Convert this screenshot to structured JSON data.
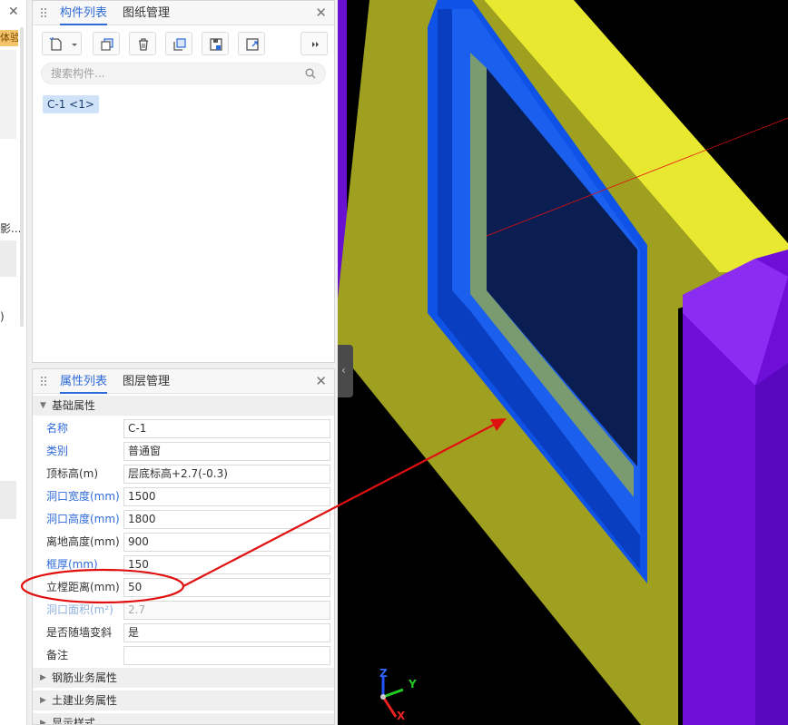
{
  "left_strip": {
    "close": "✕",
    "badge_text": "体验",
    "fragment_text": "影...",
    "fragment_text_2": ")"
  },
  "component_panel": {
    "tabs": [
      {
        "label": "构件列表",
        "active": true
      },
      {
        "label": "图纸管理",
        "active": false
      }
    ],
    "close": "✕",
    "toolbar": [
      "new-component-icon",
      "copy-icon",
      "delete-icon",
      "duplicate-icon",
      "save-icon",
      "export-icon",
      "more-icon"
    ],
    "search_placeholder": "搜索构件...",
    "items": [
      {
        "label": "C-1 <1>"
      }
    ]
  },
  "property_panel": {
    "tabs": [
      {
        "label": "属性列表",
        "active": true
      },
      {
        "label": "图层管理",
        "active": false
      }
    ],
    "close": "✕",
    "sections": {
      "basic": "基础属性",
      "rebar": "钢筋业务属性",
      "civil": "土建业务属性",
      "display": "显示样式"
    },
    "rows": [
      {
        "name": "名称",
        "value": "C-1"
      },
      {
        "name": "类别",
        "value": "普通窗"
      },
      {
        "name": "顶标高(m)",
        "value": "层底标高+2.7(-0.3)"
      },
      {
        "name": "洞口宽度(mm)",
        "value": "1500"
      },
      {
        "name": "洞口高度(mm)",
        "value": "1800"
      },
      {
        "name": "离地高度(mm)",
        "value": "900"
      },
      {
        "name": "框厚(mm)",
        "value": "150"
      },
      {
        "name": "立樘距离(mm)",
        "value": "50"
      },
      {
        "name": "洞口面积(m²)",
        "value": "2.7"
      },
      {
        "name": "是否随墙变斜",
        "value": "是"
      },
      {
        "name": "备注",
        "value": ""
      }
    ]
  },
  "viewport": {
    "axis_labels": {
      "x": "X",
      "y": "Y",
      "z": "Z"
    },
    "colors": {
      "wall": "#a0a020",
      "wall_top": "#e8e830",
      "column": "#7a10e0",
      "frame": "#0f52e8",
      "glass": "#0a1a4a",
      "annotation": "#e01010"
    }
  },
  "colors": {
    "accent": "#2f6bd8",
    "chip": "#cfe2f7"
  }
}
